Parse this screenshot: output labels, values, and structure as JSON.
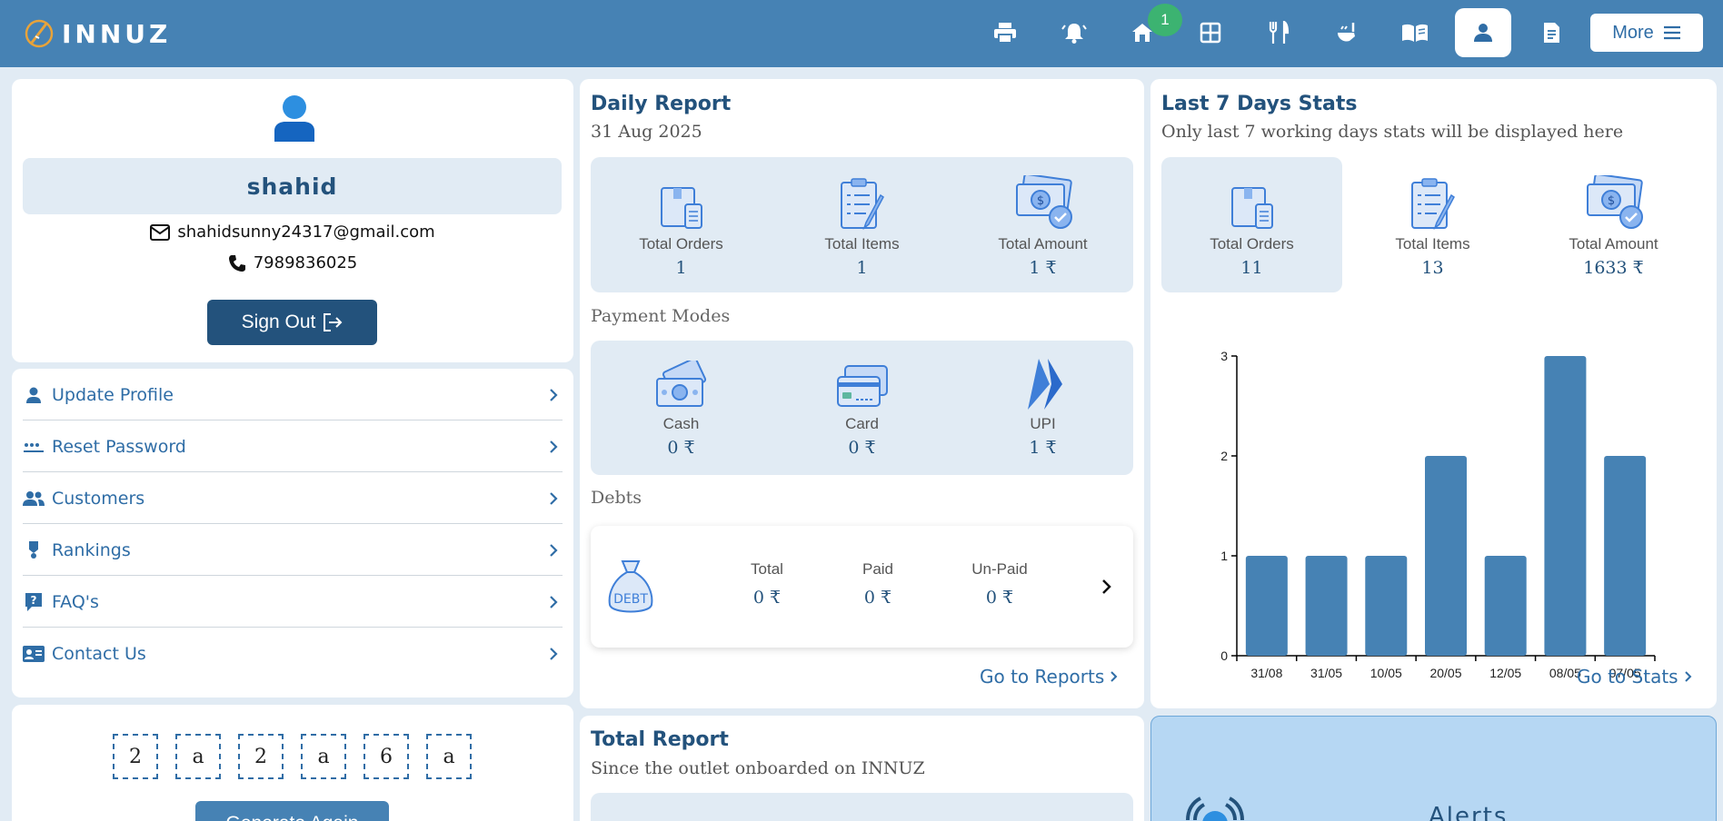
{
  "header": {
    "logo_text": "INNUZ",
    "icons": [
      "printer-icon",
      "bell-icon",
      "shop-icon",
      "table-icon",
      "cutlery-icon",
      "serving-icon",
      "menu-book-icon",
      "user-icon",
      "receipt-icon"
    ],
    "notification_count": "1",
    "more_label": "More"
  },
  "profile": {
    "name": "shahid",
    "email": "shahidsunny24317@gmail.com",
    "phone": "7989836025",
    "sign_out": "Sign Out"
  },
  "menu": {
    "items": [
      {
        "label": "Update Profile",
        "icon": "user-icon"
      },
      {
        "label": "Reset Password",
        "icon": "password-icon"
      },
      {
        "label": "Customers",
        "icon": "people-icon"
      },
      {
        "label": "Rankings",
        "icon": "medal-icon"
      },
      {
        "label": "FAQ's",
        "icon": "question-icon"
      },
      {
        "label": "Contact Us",
        "icon": "contact-card-icon"
      }
    ]
  },
  "captcha": {
    "chars": [
      "2",
      "a",
      "2",
      "a",
      "6",
      "a"
    ],
    "button": "Generate Again"
  },
  "daily": {
    "title": "Daily Report",
    "date": "31 Aug 2025",
    "stats": [
      {
        "label": "Total Orders",
        "value": "1"
      },
      {
        "label": "Total Items",
        "value": "1"
      },
      {
        "label": "Total Amount",
        "value": "1 ₹"
      }
    ],
    "payment_title": "Payment Modes",
    "payments": [
      {
        "label": "Cash",
        "value": "0 ₹"
      },
      {
        "label": "Card",
        "value": "0 ₹"
      },
      {
        "label": "UPI",
        "value": "1 ₹"
      }
    ],
    "debts_title": "Debts",
    "debt_icon_text": "DEBT",
    "debts": [
      {
        "label": "Total",
        "value": "0 ₹"
      },
      {
        "label": "Paid",
        "value": "0 ₹"
      },
      {
        "label": "Un-Paid",
        "value": "0 ₹"
      }
    ],
    "goto": "Go to Reports"
  },
  "total_report": {
    "title": "Total Report",
    "subtitle": "Since the outlet onboarded on INNUZ"
  },
  "stats7": {
    "title": "Last 7 Days Stats",
    "subtitle": "Only last 7 working days stats will be displayed here",
    "stats": [
      {
        "label": "Total Orders",
        "value": "11"
      },
      {
        "label": "Total Items",
        "value": "13"
      },
      {
        "label": "Total Amount",
        "value": "1633 ₹"
      }
    ],
    "goto": "Go to Stats"
  },
  "alerts": {
    "title": "Alerts"
  },
  "colors": {
    "primary": "#4682b4",
    "dark": "#23527c",
    "panel": "#e1ebf4",
    "badge": "#3cb371"
  },
  "chart_data": {
    "type": "bar",
    "categories": [
      "31/08",
      "31/05",
      "10/05",
      "20/05",
      "12/05",
      "08/05",
      "07/05"
    ],
    "values": [
      1,
      1,
      1,
      2,
      1,
      3,
      2
    ],
    "ylim": [
      0,
      3
    ],
    "yticks": [
      0,
      1,
      2,
      3
    ],
    "grid": false
  }
}
